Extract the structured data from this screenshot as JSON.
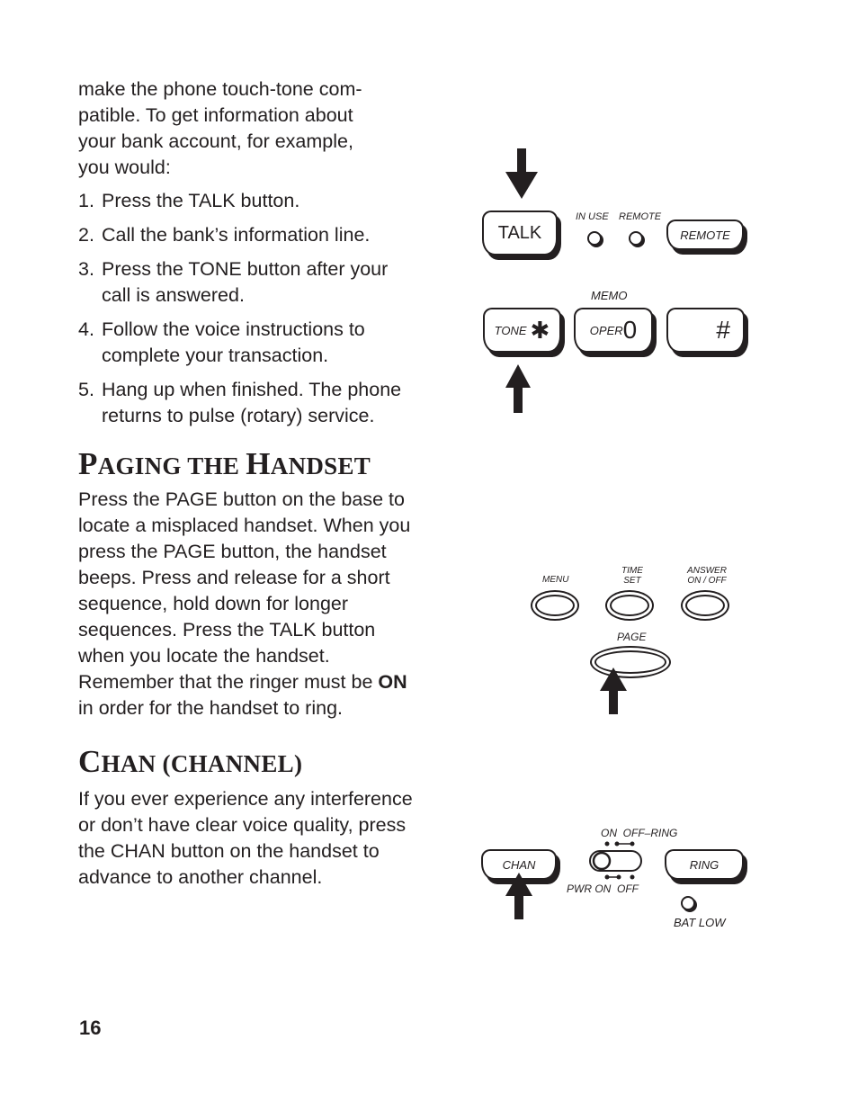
{
  "intro": {
    "text": "make the phone touch-tone compatible. To get information about your bank account, for example, you would:",
    "lines": [
      "make the phone touch-tone com-",
      "patible. To get information about",
      "your bank account, for example,",
      "you would:"
    ]
  },
  "steps": [
    {
      "num": "1.",
      "text": "Press the TALK button."
    },
    {
      "num": "2.",
      "text": "Call the bank’s information line."
    },
    {
      "num": "3.",
      "text": "Press the TONE button after your call is answered."
    },
    {
      "num": "4.",
      "text": "Follow the voice instructions to complete your transaction."
    },
    {
      "num": "5.",
      "text": "Hang up when finished. The phone returns to pulse (rotary) service."
    }
  ],
  "paging": {
    "heading_cap1": "P",
    "heading_rest1": "AGING THE ",
    "heading_cap2": "H",
    "heading_rest2": "ANDSET",
    "body_before": "Press the PAGE button on the base to locate a misplaced handset. When you press the PAGE button, the handset beeps. Press and release for a short sequence, hold down for longer sequences. Press the TALK button when you locate the handset. Remember that the ringer must be ",
    "body_bold": "ON",
    "body_after": " in order for the handset to ring."
  },
  "chan": {
    "heading_cap1": "C",
    "heading_rest1": "HAN (",
    "heading_rest2": "CHANNEL)",
    "body": "If you ever experience any interference or don’t have clear voice quality, press the CHAN button on the handset to advance to another channel."
  },
  "page_number": "16",
  "fig1": {
    "talk": "TALK",
    "in_use": "IN USE",
    "remote_led": "REMOTE",
    "remote_btn": "REMOTE",
    "memo": "MEMO",
    "tone": "TONE",
    "star": "✱",
    "oper": "OPER",
    "zero": "0",
    "hash": "#"
  },
  "fig2": {
    "menu": "MENU",
    "time1": "TIME",
    "time2": "SET",
    "answer1": "ANSWER",
    "answer2": "ON / OFF",
    "page": "PAGE"
  },
  "fig3": {
    "chan": "CHAN",
    "ring": "RING",
    "on": "ON",
    "off_ring": "OFF–RING",
    "pwr_on": "PWR ON",
    "off": "OFF",
    "bat_low": "BAT LOW"
  }
}
